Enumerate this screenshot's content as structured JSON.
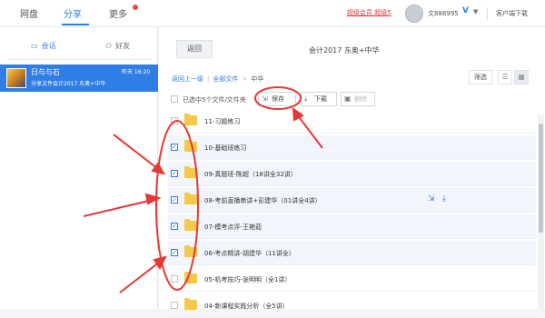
{
  "topnav": {
    "tabs": [
      {
        "label": "网盘"
      },
      {
        "label": "分享"
      },
      {
        "label": "更多"
      }
    ],
    "vip_link": "超级会员 超级5",
    "username": "文888995",
    "user_v": "V",
    "client_download": "客户端下载"
  },
  "left": {
    "tabs": [
      {
        "label": "会话",
        "icon": "chat-icon"
      },
      {
        "label": "好友",
        "icon": "friends-icon"
      }
    ],
    "conversation": {
      "name": "日与与石",
      "time": "昨天 16:20",
      "message": "分享文件会计2017 东奥+中华"
    }
  },
  "main": {
    "back_label": "返回",
    "title": "会计2017 东奥+中华",
    "breadcrumb": {
      "up": "返回上一级",
      "all": "全部文件",
      "current": "中华"
    },
    "filter_label": "筛选",
    "toolbar": {
      "selected_text": "已选中5个文件/文件夹",
      "save_label": "保存",
      "download_label": "下载",
      "delete_label": "删除"
    },
    "files": [
      {
        "name": "11-习题练习",
        "checked": false
      },
      {
        "name": "10-基础班练习",
        "checked": true
      },
      {
        "name": "09-真题班-陈超（18讲全32讲）",
        "checked": true
      },
      {
        "name": "08-考前直播串讲+彭建华（01讲全4讲）",
        "checked": true
      },
      {
        "name": "07-模考点评-王艳茹",
        "checked": true
      },
      {
        "name": "06-考点精讲-胡建华（11讲全）",
        "checked": true
      },
      {
        "name": "05-机考技巧-张明明（全1讲）",
        "checked": false
      },
      {
        "name": "04-新课程实践分析（全5讲）",
        "checked": false
      }
    ]
  },
  "colors": {
    "accent": "#2f7ee6",
    "annotation_red": "#e53935",
    "folder": "#f6c94a"
  }
}
